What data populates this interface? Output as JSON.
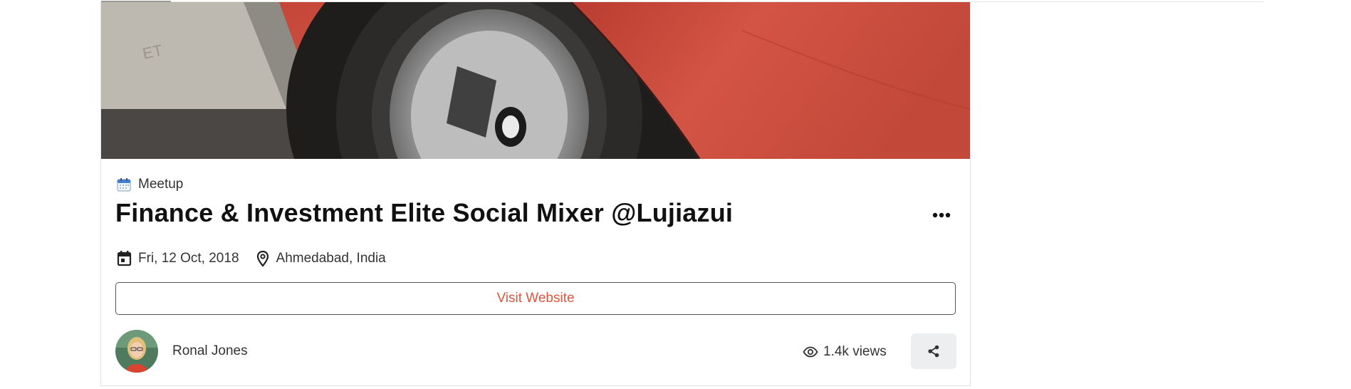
{
  "event": {
    "category": "Meetup",
    "category_icon": "calendar-emoji-icon",
    "title": "Finance & Investment Elite Social Mixer @Lujiazui",
    "date": "Fri, 12 Oct, 2018",
    "location": "Ahmedabad, India",
    "visit_label": "Visit Website",
    "author_name": "Ronal Jones",
    "views": "1.4k views"
  },
  "colors": {
    "accent": "#d9573f",
    "car_red": "#c94a3a",
    "share_bg": "#eceef0"
  },
  "icons": {
    "more": "more-horizontal-icon",
    "date": "calendar-icon",
    "location": "map-pin-icon",
    "views": "eye-icon",
    "share": "share-icon"
  }
}
